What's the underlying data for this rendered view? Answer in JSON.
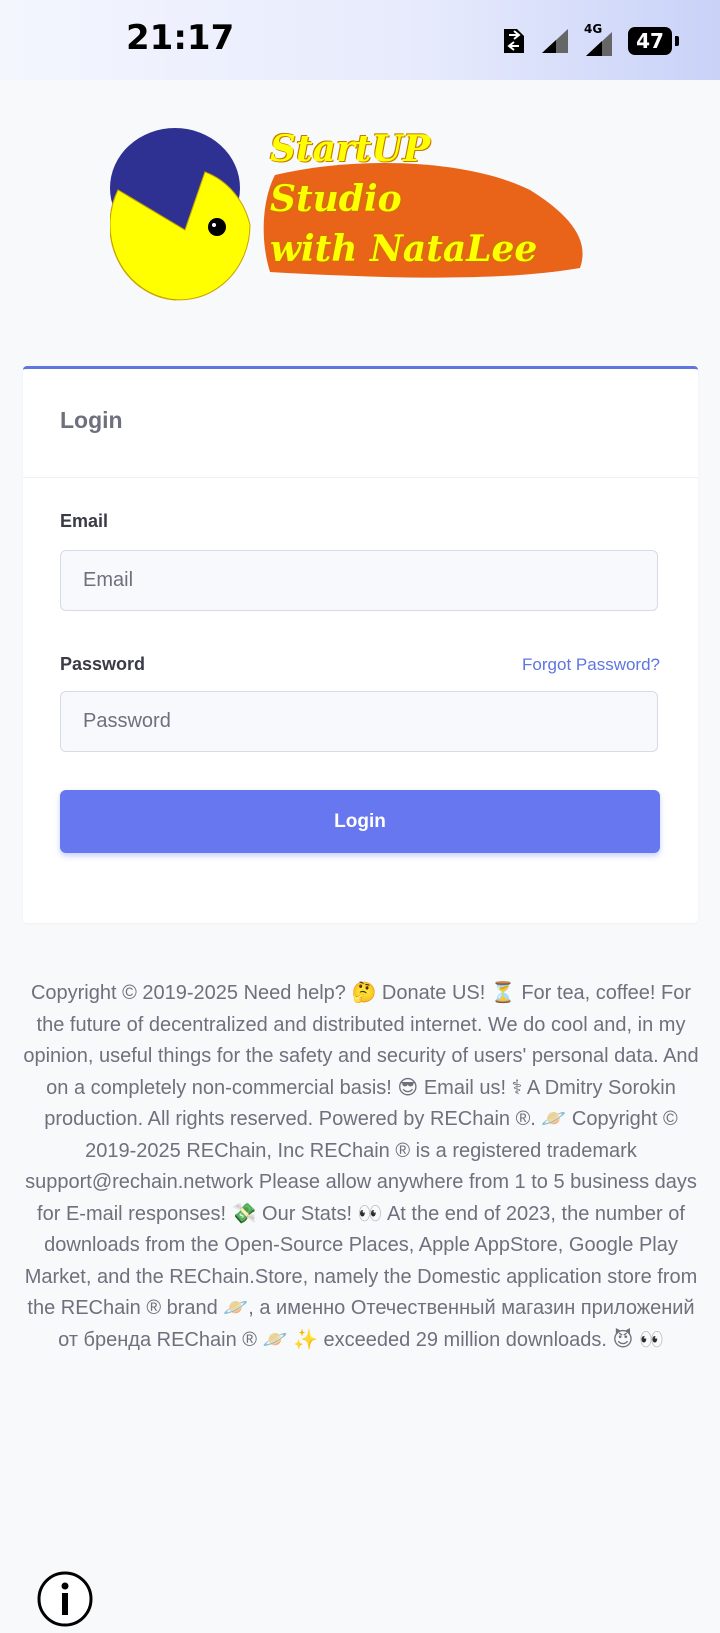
{
  "status_bar": {
    "time": "21:17",
    "network_label": "4G",
    "battery": "47",
    "icons": [
      "sim-card-icon",
      "signal-icon",
      "signal-4g-icon",
      "battery-icon"
    ]
  },
  "logo": {
    "line1": "StartUP",
    "line2": "Studio",
    "line3": "with NataLee"
  },
  "login_card": {
    "title": "Login",
    "email_label": "Email",
    "email_placeholder": "Email",
    "email_value": "",
    "password_label": "Password",
    "password_placeholder": "Password",
    "password_value": "",
    "forgot_link": "Forgot Password?",
    "submit_label": "Login"
  },
  "colors": {
    "primary": "#6777ef",
    "card_accent": "#5f75e0",
    "background": "#f8f9fa",
    "logo_orange": "#e85b0c",
    "logo_yellow": "#ffff00",
    "logo_blue": "#2e3192"
  },
  "footer": {
    "text": "Copyright © 2019-2025 Need help? 🤔 Donate US! ⏳ For tea, coffee! For the future of decentralized and distributed internet. We do cool and, in my opinion, useful things for the safety and security of users' personal data. And on a completely non-commercial basis! 😎 Email us! ⚕ A Dmitry Sorokin production. All rights reserved. Powered by REChain ®. 🪐 Copyright © 2019-2025 REChain, Inc REChain ® is a registered trademark support@rechain.network Please allow anywhere from 1 to 5 business days for E-mail responses! 💸 Our Stats! 👀 At the end of 2023, the number of downloads from the Open-Source Places, Apple AppStore, Google Play Market, and the REChain.Store, namely the Domestic application store from the REChain ® brand 🪐, а именно Отечественный магазин приложений от бренда REChain ® 🪐 ✨ exceeded 29 million downloads. 😈 👀"
  },
  "info_button": {
    "icon": "info-icon"
  }
}
